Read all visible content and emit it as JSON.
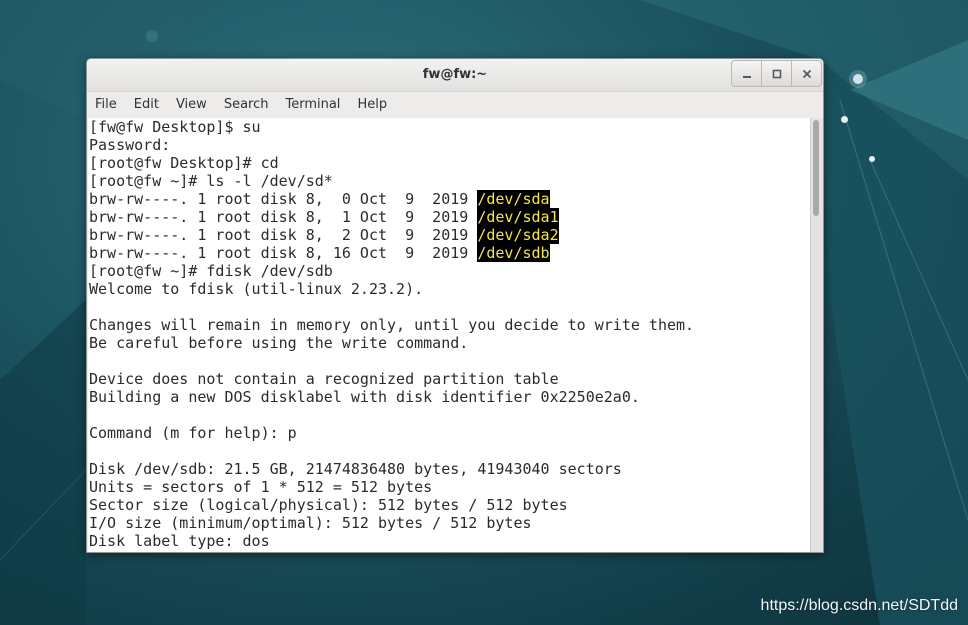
{
  "desktop": {
    "background_color": "#1d5663",
    "watermark": "https://blog.csdn.net/SDTdd"
  },
  "window": {
    "title": "fw@fw:~",
    "controls": {
      "minimize_icon": "minimize-icon",
      "maximize_icon": "maximize-icon",
      "close_icon": "close-icon"
    }
  },
  "menubar": {
    "items": [
      "File",
      "Edit",
      "View",
      "Search",
      "Terminal",
      "Help"
    ]
  },
  "terminal": {
    "highlight_color": "#f3e64d",
    "lines": [
      {
        "text": "[fw@fw Desktop]$ su"
      },
      {
        "text": "Password:"
      },
      {
        "text": "[root@fw Desktop]# cd"
      },
      {
        "text": "[root@fw ~]# ls -l /dev/sd*"
      },
      {
        "text": "brw-rw----. 1 root disk 8,  0 Oct  9  2019 ",
        "highlight": "/dev/sda"
      },
      {
        "text": "brw-rw----. 1 root disk 8,  1 Oct  9  2019 ",
        "highlight": "/dev/sda1"
      },
      {
        "text": "brw-rw----. 1 root disk 8,  2 Oct  9  2019 ",
        "highlight": "/dev/sda2"
      },
      {
        "text": "brw-rw----. 1 root disk 8, 16 Oct  9  2019 ",
        "highlight": "/dev/sdb"
      },
      {
        "text": "[root@fw ~]# fdisk /dev/sdb"
      },
      {
        "text": "Welcome to fdisk (util-linux 2.23.2)."
      },
      {
        "text": ""
      },
      {
        "text": "Changes will remain in memory only, until you decide to write them."
      },
      {
        "text": "Be careful before using the write command."
      },
      {
        "text": ""
      },
      {
        "text": "Device does not contain a recognized partition table"
      },
      {
        "text": "Building a new DOS disklabel with disk identifier 0x2250e2a0."
      },
      {
        "text": ""
      },
      {
        "text": "Command (m for help): p"
      },
      {
        "text": ""
      },
      {
        "text": "Disk /dev/sdb: 21.5 GB, 21474836480 bytes, 41943040 sectors"
      },
      {
        "text": "Units = sectors of 1 * 512 = 512 bytes"
      },
      {
        "text": "Sector size (logical/physical): 512 bytes / 512 bytes"
      },
      {
        "text": "I/O size (minimum/optimal): 512 bytes / 512 bytes"
      },
      {
        "text": "Disk label type: dos"
      }
    ]
  }
}
